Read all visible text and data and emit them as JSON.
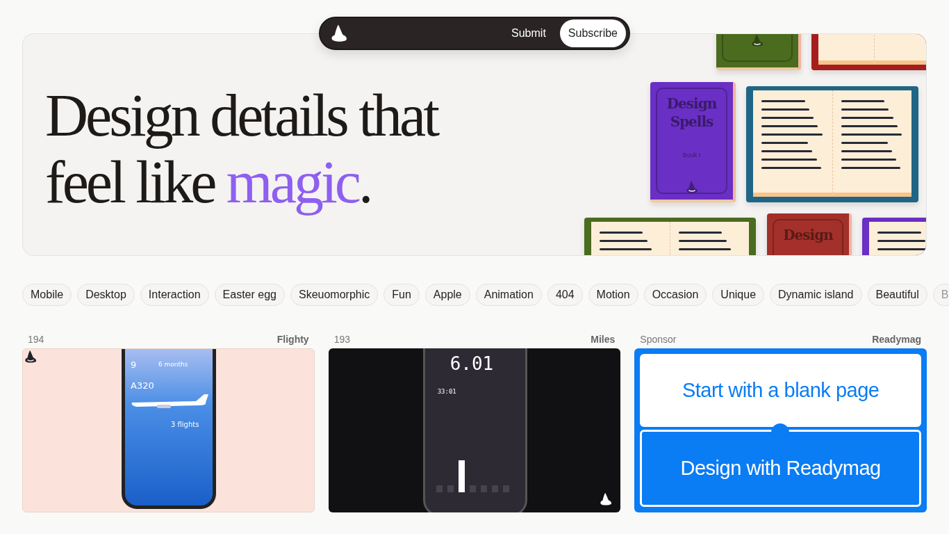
{
  "nav": {
    "buttons": [
      {
        "label": "Submit",
        "kind": "plain"
      },
      {
        "label": "Subscribe",
        "kind": "filled"
      }
    ]
  },
  "hero": {
    "line1": "Design details that",
    "line2": "feel like ",
    "accent": "magic",
    "end": ".",
    "books": [
      {
        "kind": "closed",
        "color": "#4b6b1e"
      },
      {
        "kind": "open",
        "color": "#a61d1d"
      },
      {
        "kind": "closed",
        "color": "#6a2fc4",
        "title": "Design Spells",
        "subtitle": "Book I"
      },
      {
        "kind": "open",
        "color": "#1f6585"
      },
      {
        "kind": "open",
        "color": "#4b6b1e"
      },
      {
        "kind": "closed",
        "color": "#a3302a",
        "title": "Design"
      },
      {
        "kind": "open",
        "color": "#6a2fc4"
      }
    ]
  },
  "tags": [
    {
      "label": "Mobile",
      "faded": false
    },
    {
      "label": "Desktop",
      "faded": false
    },
    {
      "label": "Interaction",
      "faded": false
    },
    {
      "label": "Easter egg",
      "faded": false
    },
    {
      "label": "Skeuomorphic",
      "faded": false
    },
    {
      "label": "Fun",
      "faded": false
    },
    {
      "label": "Apple",
      "faded": false
    },
    {
      "label": "Animation",
      "faded": false
    },
    {
      "label": "404",
      "faded": false
    },
    {
      "label": "Motion",
      "faded": false
    },
    {
      "label": "Occasion",
      "faded": false
    },
    {
      "label": "Unique",
      "faded": false
    },
    {
      "label": "Dynamic island",
      "faded": false
    },
    {
      "label": "Beautiful",
      "faded": false
    },
    {
      "label": "B",
      "faded": true
    }
  ],
  "cards": [
    {
      "kind": "flighty",
      "label": "194",
      "source": "Flighty",
      "screen": [
        "9",
        "6 months",
        "A320",
        "3 flights"
      ]
    },
    {
      "kind": "miles",
      "label": "193",
      "source": "Miles",
      "screen": [
        "6.01",
        "33:01"
      ]
    },
    {
      "kind": "sponsor",
      "label": "Sponsor",
      "source": "Readymag",
      "screen": [
        "Start with a blank page",
        "Design with Readymag"
      ]
    }
  ]
}
